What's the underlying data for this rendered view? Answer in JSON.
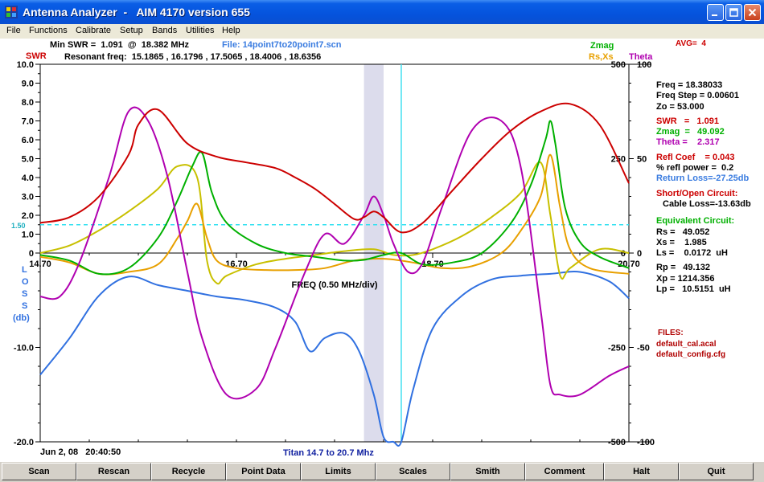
{
  "window": {
    "title": "Antenna Analyzer  -   AIM 4170 version 655",
    "minimize_icon": "minimize-icon",
    "maximize_icon": "maximize-icon",
    "close_icon": "close-icon"
  },
  "menu": [
    "File",
    "Functions",
    "Calibrate",
    "Setup",
    "Bands",
    "Utilities",
    "Help"
  ],
  "header": {
    "min_swr": "Min SWR =  1.091  @  18.382 MHz",
    "file": "File: 14point7to20point7.scn",
    "resonant": "Resonant freq:  15.1865 , 16.1796 , 17.5065 , 18.4006 , 18.6356",
    "avg": "AVG=  4",
    "swr_label": "SWR",
    "zmag_label": "Zmag",
    "rsxs_label": "Rs,Xs",
    "theta_label": "Theta"
  },
  "colors": {
    "swr": "#cc0000",
    "zmag": "#00b000",
    "rsxs": "#e8a000",
    "xs": "#c8c000",
    "theta": "#b000b0",
    "loss": "#3070e0",
    "cursor": "#40e0f0",
    "swr_ref": "#30e0f0",
    "band": "#dcdcec"
  },
  "axes": {
    "swr_ticks": [
      "10.0",
      "9.0",
      "8.0",
      "7.0",
      "6.0",
      "5.0",
      "4.0",
      "3.0",
      "2.0",
      "1.0",
      "0"
    ],
    "swr_ref_label": "1.50",
    "loss_ticks": [
      "-10.0",
      "-20.0"
    ],
    "loss_label": [
      "L",
      "O",
      "S",
      "S",
      "(db)"
    ],
    "freq_ticks": [
      "14.70",
      "16.70",
      "18.70",
      "20.70"
    ],
    "freq_div": "FREQ (0.50 MHz/div)",
    "z_ticks": [
      "500",
      "250",
      "0",
      "-250",
      "-500"
    ],
    "theta_ticks": [
      "100",
      "50",
      "0",
      "-50",
      "-100"
    ]
  },
  "readout": {
    "freq": "Freq =  18.38033",
    "step": "Freq Step =  0.00601",
    "zo": "Zo =   53.000",
    "swr": "SWR   =   1.091",
    "zmag": "Zmag  =   49.092",
    "theta": "Theta =    2.317",
    "refl": "Refl Coef    = 0.043",
    "refl_power": "% refl power =  0.2",
    "return_loss": "Return Loss=-27.25db",
    "short_open": "Short/Open Circuit:",
    "cable_loss": "Cable Loss=-13.63db",
    "equiv": "Equivalent Circuit:",
    "rs": "Rs =   49.052",
    "xs": "Xs =    1.985",
    "ls": "Ls =    0.0172  uH",
    "rp": "Rp =   49.132",
    "xp": "Xp = 1214.356",
    "lp": "Lp =   10.5151  uH",
    "files": "FILES:",
    "file1": "default_cal.acal",
    "file2": "default_config.cfg"
  },
  "footer": {
    "date": "Jun 2, 08   20:40:50",
    "titan": "Titan 14.7 to 20.7 Mhz"
  },
  "buttons": [
    "Scan",
    "Rescan",
    "Recycle",
    "Point Data",
    "Limits",
    "Scales",
    "Smith",
    "Comment",
    "Halt",
    "Quit"
  ],
  "chart_data": {
    "type": "line",
    "x_range": [
      14.7,
      20.7
    ],
    "swr_ylim": [
      0,
      10
    ],
    "loss_ylim": [
      -20,
      0
    ],
    "z_ylim": [
      -500,
      500
    ],
    "theta_ylim": [
      -100,
      100
    ],
    "cursor_freq": 18.38,
    "marker_band": [
      18.0,
      18.2
    ],
    "swr_reference": 1.5,
    "series": [
      {
        "name": "SWR",
        "x": [
          14.7,
          15.0,
          15.3,
          15.6,
          15.7,
          15.9,
          16.2,
          16.5,
          16.8,
          17.1,
          17.3,
          17.5,
          17.7,
          17.9,
          18.0,
          18.1,
          18.2,
          18.38,
          18.6,
          18.9,
          19.2,
          19.5,
          19.8,
          20.1,
          20.4,
          20.7
        ],
        "values": [
          1.6,
          1.9,
          3.0,
          5.2,
          6.8,
          7.6,
          5.8,
          5.1,
          4.8,
          4.5,
          4.0,
          3.4,
          2.6,
          1.8,
          1.9,
          2.2,
          1.9,
          1.1,
          1.6,
          3.3,
          5.0,
          6.5,
          7.5,
          7.9,
          6.8,
          3.7
        ]
      },
      {
        "name": "Zmag",
        "x": [
          14.7,
          15.0,
          15.3,
          15.6,
          15.9,
          16.1,
          16.25,
          16.35,
          16.45,
          16.6,
          16.9,
          17.2,
          17.5,
          17.8,
          18.0,
          18.2,
          18.38,
          18.6,
          18.9,
          19.2,
          19.5,
          19.7,
          19.85,
          19.9,
          19.95,
          20.05,
          20.2,
          20.4,
          20.7
        ],
        "values": [
          -5,
          -20,
          -55,
          -40,
          40,
          140,
          230,
          265,
          160,
          80,
          25,
          0,
          -10,
          -20,
          -18,
          -5,
          0,
          -30,
          -25,
          0,
          80,
          180,
          300,
          350,
          290,
          120,
          30,
          -10,
          -40
        ]
      },
      {
        "name": "Rs",
        "x": [
          14.7,
          15.0,
          15.3,
          15.6,
          15.9,
          16.1,
          16.2,
          16.3,
          16.4,
          16.5,
          16.7,
          17.0,
          17.3,
          17.6,
          17.9,
          18.2,
          18.5,
          18.8,
          19.1,
          19.4,
          19.6,
          19.8,
          19.9,
          20.0,
          20.1,
          20.3,
          20.7
        ],
        "values": [
          -10,
          -25,
          -55,
          -50,
          -30,
          40,
          85,
          130,
          40,
          -20,
          -40,
          -45,
          -45,
          -40,
          -20,
          -15,
          -25,
          -40,
          -35,
          0,
          60,
          150,
          260,
          120,
          10,
          -40,
          -55
        ]
      },
      {
        "name": "Xs",
        "x": [
          14.7,
          15.0,
          15.3,
          15.6,
          15.9,
          16.1,
          16.3,
          16.4,
          16.5,
          16.6,
          16.9,
          17.2,
          17.5,
          17.8,
          18.1,
          18.3,
          18.5,
          18.7,
          19.0,
          19.3,
          19.6,
          19.8,
          19.9,
          20.0,
          20.1,
          20.4,
          20.7
        ],
        "values": [
          0,
          20,
          60,
          110,
          170,
          230,
          200,
          -20,
          -80,
          -60,
          -30,
          -15,
          -5,
          5,
          10,
          -5,
          -5,
          10,
          45,
          95,
          160,
          240,
          100,
          -60,
          -40,
          10,
          0
        ]
      },
      {
        "name": "Theta",
        "x": [
          14.7,
          14.9,
          15.1,
          15.4,
          15.6,
          15.8,
          16.0,
          16.2,
          16.35,
          16.6,
          16.9,
          17.1,
          17.4,
          17.6,
          17.8,
          18.0,
          18.1,
          18.2,
          18.3,
          18.45,
          18.6,
          18.8,
          19.1,
          19.4,
          19.6,
          19.8,
          19.9,
          20.0,
          20.2,
          20.5,
          20.7
        ],
        "values": [
          -23,
          -23,
          -5,
          40,
          75,
          70,
          40,
          -10,
          -45,
          -75,
          -72,
          -50,
          -10,
          10,
          5,
          20,
          30,
          20,
          5,
          -10,
          -5,
          25,
          65,
          70,
          45,
          -30,
          -70,
          -75,
          -75,
          -65,
          -60
        ]
      },
      {
        "name": "Return Loss",
        "x": [
          14.7,
          15.0,
          15.3,
          15.6,
          15.9,
          16.2,
          16.5,
          16.8,
          17.1,
          17.3,
          17.45,
          17.6,
          17.8,
          17.95,
          18.1,
          18.2,
          18.3,
          18.38,
          18.5,
          18.7,
          19.0,
          19.3,
          19.6,
          19.9,
          20.2,
          20.5,
          20.7
        ],
        "values": [
          -12.9,
          -9.0,
          -4.5,
          -2.5,
          -3.4,
          -4.0,
          -4.6,
          -5.0,
          -5.8,
          -7.3,
          -10.4,
          -9.0,
          -8.5,
          -10.4,
          -15.0,
          -19.5,
          -20.0,
          -20.0,
          -14.5,
          -8.0,
          -4.5,
          -2.8,
          -2.4,
          -2.2,
          -2.0,
          -3.0,
          -4.8
        ]
      }
    ]
  }
}
